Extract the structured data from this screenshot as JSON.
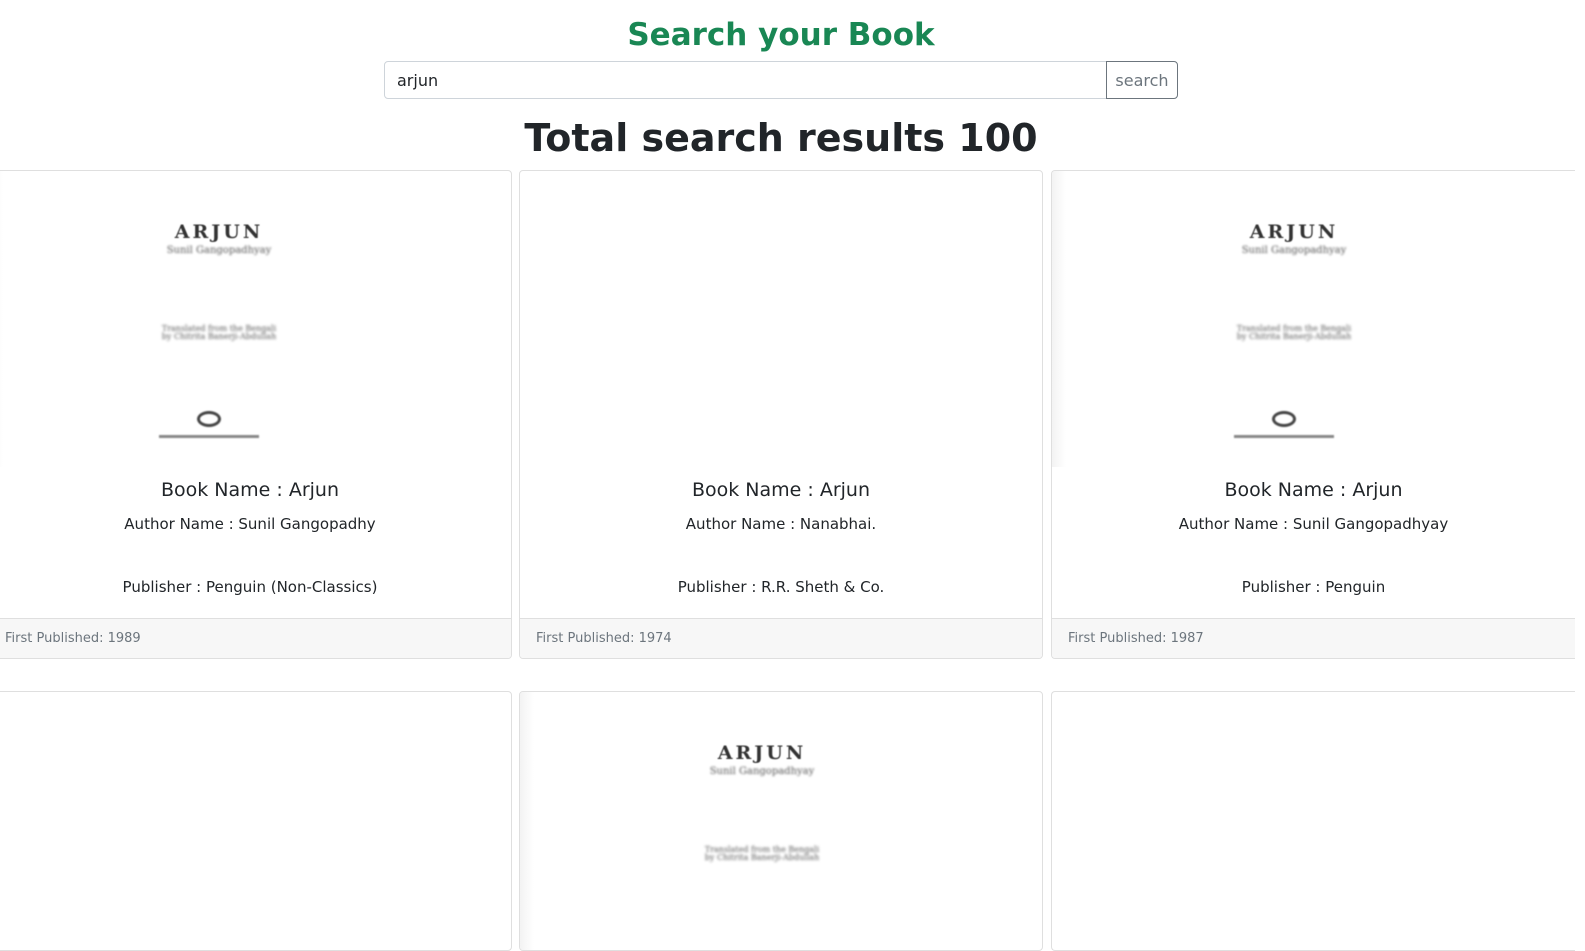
{
  "header": {
    "title": "Search your Book",
    "search": {
      "value": "arjun",
      "button_label": "search"
    }
  },
  "results": {
    "heading": "Total search results 100"
  },
  "cover_art": {
    "title": "ARJUN",
    "author": "Sunil Gangopadhyay",
    "translation_line1": "Translated from the Bengali",
    "translation_line2": "by Chitrita Banerji-Abdullah"
  },
  "cards": [
    {
      "book_name": "Book Name : Arjun",
      "author": "Author Name : Sunil Gangopadhy",
      "publisher": "Publisher : Penguin (Non-Classics)",
      "first_published": "First Published: 1989",
      "has_cover": true
    },
    {
      "book_name": "Book Name : Arjun",
      "author": "Author Name : Nanabhai.",
      "publisher": "Publisher : R.R. Sheth & Co.",
      "first_published": "First Published: 1974",
      "has_cover": false
    },
    {
      "book_name": "Book Name : Arjun",
      "author": "Author Name : Sunil Gangopadhyay",
      "publisher": "Publisher : Penguin",
      "first_published": "First Published: 1987",
      "has_cover": true
    },
    {
      "has_cover": false
    },
    {
      "has_cover": true
    },
    {
      "has_cover": false
    }
  ]
}
